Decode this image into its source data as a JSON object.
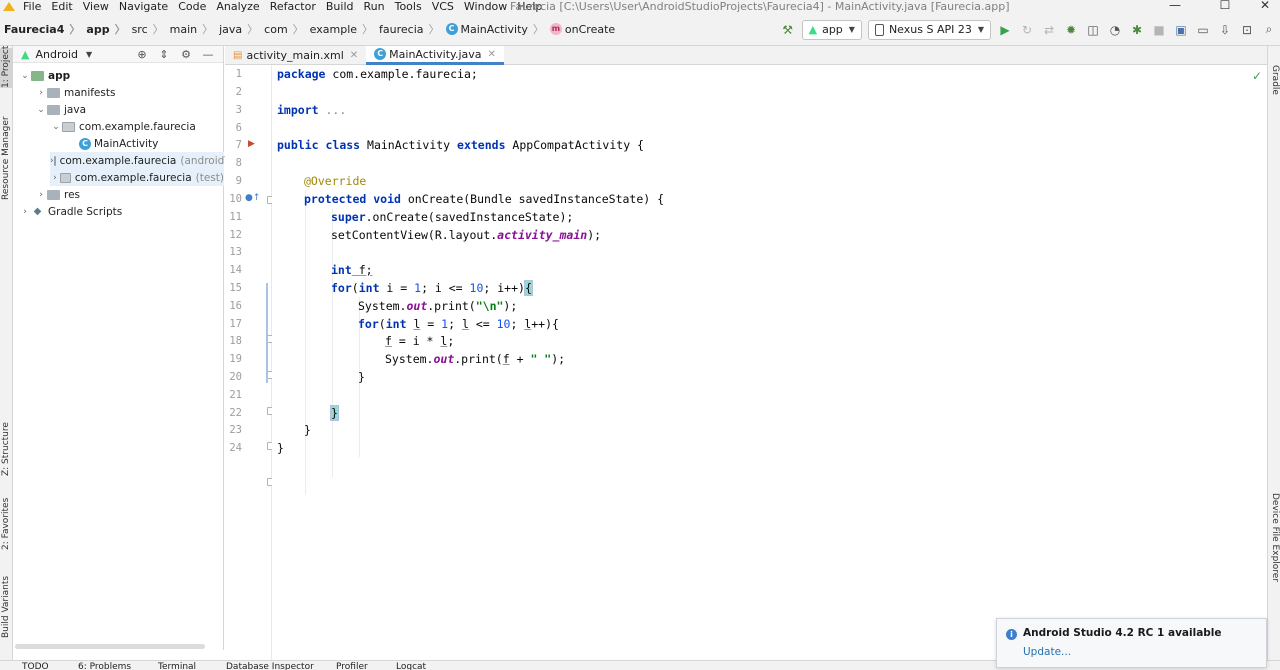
{
  "menu": [
    "File",
    "Edit",
    "View",
    "Navigate",
    "Code",
    "Analyze",
    "Refactor",
    "Build",
    "Run",
    "Tools",
    "VCS",
    "Window",
    "Help"
  ],
  "window_title": "Faurecia [C:\\Users\\User\\AndroidStudioProjects\\Faurecia4] - MainActivity.java [Faurecia.app]",
  "breadcrumbs": [
    "Faurecia4",
    "app",
    "src",
    "main",
    "java",
    "com",
    "example",
    "faurecia",
    "MainActivity",
    "onCreate"
  ],
  "toolbar": {
    "run_config": "app",
    "device": "Nexus S API 23"
  },
  "left_tabs": {
    "project": "1: Project",
    "resource_manager": "Resource Manager",
    "structure": "Z: Structure",
    "favorites": "2: Favorites",
    "build_variants": "Build Variants"
  },
  "project_panel": {
    "view_mode": "Android",
    "tree": [
      {
        "label": "app",
        "suffix": ""
      },
      {
        "label": "manifests",
        "suffix": ""
      },
      {
        "label": "java",
        "suffix": ""
      },
      {
        "label": "com.example.faurecia",
        "suffix": ""
      },
      {
        "label": "MainActivity",
        "suffix": ""
      },
      {
        "label": "com.example.faurecia",
        "suffix": "(androidT"
      },
      {
        "label": "com.example.faurecia",
        "suffix": "(test)"
      },
      {
        "label": "res",
        "suffix": ""
      },
      {
        "label": "Gradle Scripts",
        "suffix": ""
      }
    ]
  },
  "editor_tabs": [
    {
      "label": "activity_main.xml"
    },
    {
      "label": "MainActivity.java"
    }
  ],
  "line_numbers": [
    "1",
    "2",
    "3",
    "6",
    "7",
    "8",
    "9",
    "10",
    "11",
    "12",
    "13",
    "14",
    "15",
    "16",
    "17",
    "18",
    "19",
    "20",
    "21",
    "22",
    "23",
    "24"
  ],
  "code": {
    "package": "package",
    "package_name": " com.example.faurecia;",
    "import": "import",
    "import_fold": " ...",
    "public": "public",
    "class": " class",
    "class_name": " MainActivity ",
    "extends": "extends",
    "superclass": " AppCompatActivity {",
    "override": "@Override",
    "protected": "protected",
    "void": " void",
    "oncreate_sig": " onCreate(Bundle savedInstanceState) {",
    "super": "super",
    "super_call": ".onCreate(savedInstanceState);",
    "set_content": "setContentView(R.layout.",
    "activity_main": "activity_main",
    "set_content_end": ");",
    "int_kw": "int",
    "var_f": " f;",
    "for_kw": "for",
    "for_open": "(",
    "i_decl": " i = ",
    "one": "1",
    "i_cond": "; i <= ",
    "ten": "10",
    "i_inc": "; i++)",
    "brace_open": "{",
    "system": "System.",
    "out": "out",
    "print": ".print(",
    "newline_str": "\"\\n\"",
    "close_stmt": ");",
    "l_var": "l",
    "l_decl_rest": " = ",
    "l_cond_a": "; ",
    "l_cond_b": " <= ",
    "l_inc_a": "; ",
    "l_inc_b": "++){",
    "f_var": "f",
    "f_assign": " = i * ",
    "semi": ";",
    "f_plus": " + ",
    "space_str": "\" \"",
    "brace_close": "}"
  },
  "bottom_tabs": [
    "TODO",
    "6: Problems",
    "Terminal",
    "Database Inspector",
    "Profiler",
    "Logcat"
  ],
  "right_tabs": {
    "gradle": "Gradle",
    "device_explorer": "Device File Explorer"
  },
  "notification": {
    "title": "Android Studio 4.2 RC 1 available",
    "link": "Update..."
  },
  "colors": {
    "keyword": "#0033b3",
    "annotation": "#9e880d",
    "number": "#1750eb",
    "string": "#067d17",
    "field": "#871094",
    "current_line": "#fdfae3",
    "accent": "#4083c9"
  }
}
